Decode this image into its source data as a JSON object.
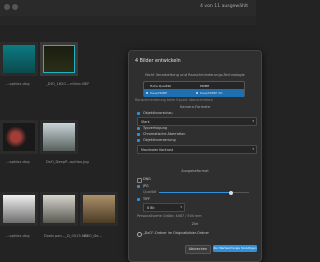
{
  "header": {
    "selection_count": "4 von 11 ausgewählt"
  },
  "thumbnails": [
    {
      "caption": "...ophlax.dng"
    },
    {
      "caption": "_DfO_1620....ntlinic.NEF",
      "selected": true
    },
    {
      "caption": "...ophlax.dng"
    },
    {
      "caption": "DxO_DeepP...ophlax.jpg"
    },
    {
      "caption": "...ophlax.dng"
    },
    {
      "caption": "Dxols pan..._D_0013.NEF"
    },
    {
      "caption": "DxO_De..."
    }
  ],
  "panel": {
    "title": "4 Bilder entwickeln",
    "denoise_section": "Nicht Verarbeitung und Rauschminderungs-Technologie",
    "denoise_options": [
      {
        "label": "Hohe Qualität",
        "active": false
      },
      {
        "label": "PRIME",
        "active": false
      },
      {
        "label": "DeepPRIME",
        "active": true
      },
      {
        "label": "DeepPRIME XD",
        "active": true
      }
    ],
    "denoise_note": "Rauschminderung beim Export überschreiben",
    "format_section": "Kamera-Formate",
    "options": [
      {
        "label": "Objektivvorschau",
        "checked": true
      },
      {
        "label": "Typverfolgung",
        "checked": true
      },
      {
        "label": "Chromatische Aberration",
        "checked": true
      },
      {
        "label": "Objektivverzerrung",
        "checked": true
      }
    ],
    "dropdown_top": "Stark",
    "dropdown_bottom": "Maximaler Kontrast",
    "output_section": "Ausgabeformat",
    "output_formats": [
      {
        "label": "DNG",
        "checked": false
      },
      {
        "label": "JPG",
        "checked": true
      },
      {
        "label": "TIFF",
        "checked": true
      }
    ],
    "quality_label": "Qualität",
    "tiff_value": "8 Bit",
    "size_label": "Personalisierte Größe: 4467 / 504 mm",
    "destination_label": "Ziel",
    "destination_option": "„DxO“-Ordner im Originalbilder-Ordner",
    "cancel": "Abbrechen",
    "process": "Zur Warteschlange hinzufügen"
  }
}
